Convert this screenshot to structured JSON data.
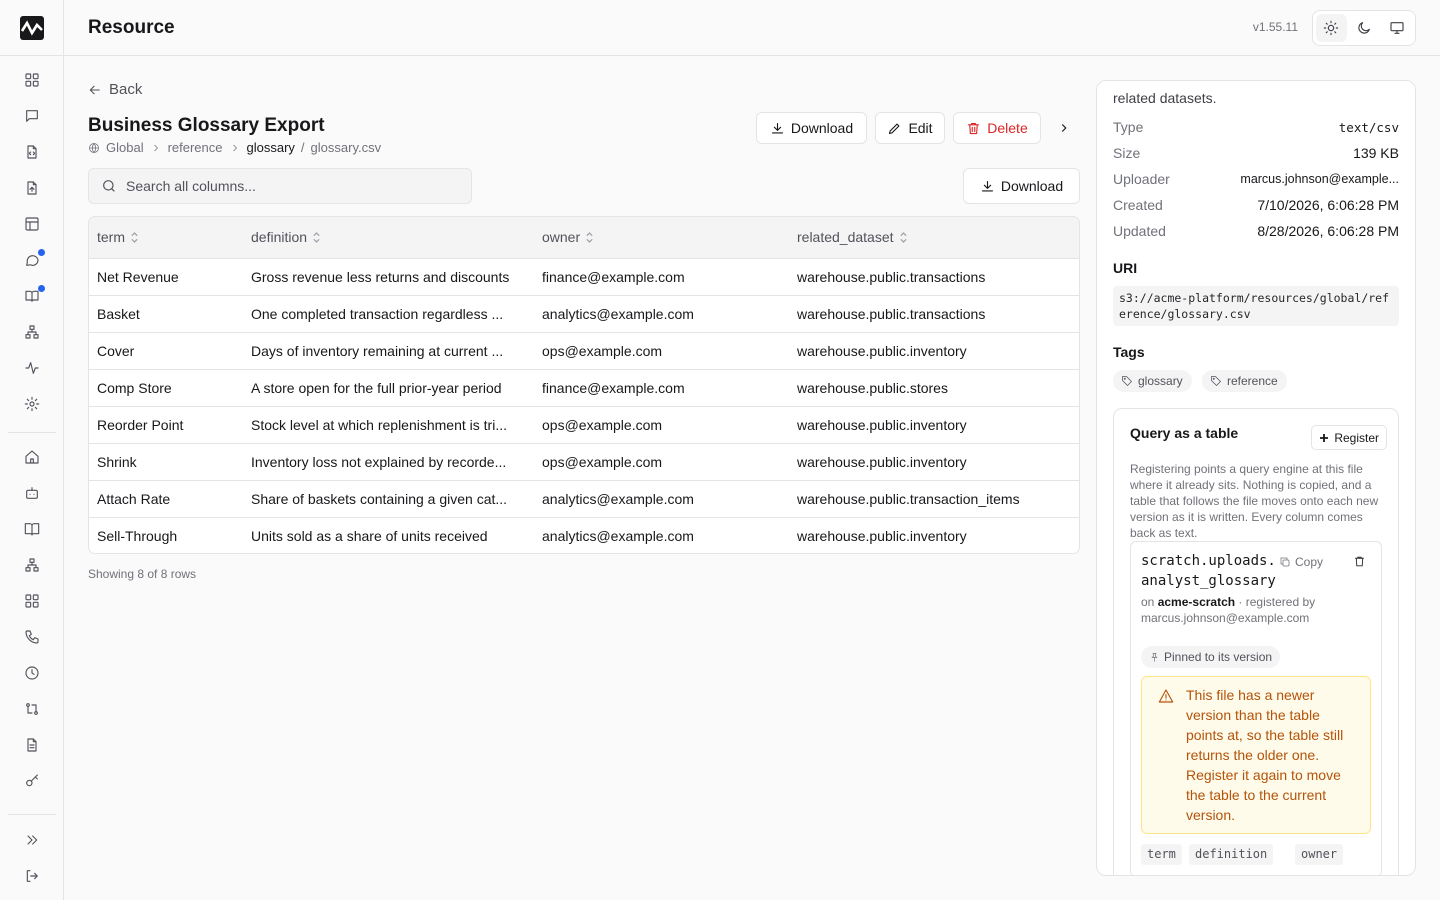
{
  "header": {
    "title": "Resource",
    "version": "v1.55.11"
  },
  "sidebar": {
    "icons": [
      "dashboard-icon",
      "chat-icon",
      "file-code-icon",
      "file-upload-icon",
      "table-icon",
      "messages-icon",
      "book-icon",
      "network-icon",
      "activity-icon",
      "settings-icon",
      "home-icon",
      "bot-icon",
      "book-open-icon",
      "org-chart-icon",
      "grid-icon",
      "phone-icon",
      "clock-icon",
      "git-compare-icon",
      "document-icon",
      "key-icon",
      "expand-icon",
      "logout-icon"
    ]
  },
  "page": {
    "back_label": "Back",
    "title": "Business Glossary Export",
    "breadcrumb": [
      "Global",
      "reference",
      "glossary",
      "glossary.csv"
    ],
    "actions": {
      "download": "Download",
      "edit": "Edit",
      "delete": "Delete"
    },
    "search_placeholder": "Search all columns...",
    "download_label": "Download",
    "row_count": "Showing 8 of 8 rows"
  },
  "table": {
    "columns": [
      "term",
      "definition",
      "owner",
      "related_dataset"
    ],
    "rows": [
      [
        "Net Revenue",
        "Gross revenue less returns and discounts",
        "finance@example.com",
        "warehouse.public.transactions"
      ],
      [
        "Basket",
        "One completed transaction regardless ...",
        "analytics@example.com",
        "warehouse.public.transactions"
      ],
      [
        "Cover",
        "Days of inventory remaining at current ...",
        "ops@example.com",
        "warehouse.public.inventory"
      ],
      [
        "Comp Store",
        "A store open for the full prior-year period",
        "finance@example.com",
        "warehouse.public.stores"
      ],
      [
        "Reorder Point",
        "Stock level at which replenishment is tri...",
        "ops@example.com",
        "warehouse.public.inventory"
      ],
      [
        "Shrink",
        "Inventory loss not explained by recorde...",
        "ops@example.com",
        "warehouse.public.inventory"
      ],
      [
        "Attach Rate",
        "Share of baskets containing a given cat...",
        "analytics@example.com",
        "warehouse.public.transaction_items"
      ],
      [
        "Sell-Through",
        "Units sold as a share of units received",
        "analytics@example.com",
        "warehouse.public.inventory"
      ]
    ]
  },
  "details": {
    "description_tail": "related datasets.",
    "meta": [
      {
        "key": "Type",
        "value": "text/csv"
      },
      {
        "key": "Size",
        "value": "139 KB"
      },
      {
        "key": "Uploader",
        "value": "marcus.johnson@example..."
      },
      {
        "key": "Created",
        "value": "7/10/2026, 6:06:28 PM"
      },
      {
        "key": "Updated",
        "value": "8/28/2026, 6:06:28 PM"
      }
    ],
    "uri_label": "URI",
    "uri": "s3://acme-platform/resources/global/reference/glossary.csv",
    "tags_label": "Tags",
    "tags": [
      "glossary",
      "reference"
    ]
  },
  "query": {
    "title": "Query as a table",
    "register_label": "Register",
    "description": "Registering points a query engine at this file where it already sits. Nothing is copied, and a table that follows the file moves onto each new version as it is written. Every column comes back as text.",
    "registration": {
      "name_line1": "scratch.uploads.",
      "name_line2": "analyst_glossary",
      "copy_label": "Copy",
      "on_label": "on",
      "engine": "acme-scratch",
      "registered_by_label": "registered by",
      "registered_by": "marcus.johnson@example.com",
      "pin_label": "Pinned to its version",
      "warning": "This file has a newer version than the table points at, so the table still returns the older one. Register it again to move the table to the current version.",
      "columns": [
        "term",
        "definition",
        "owner"
      ]
    }
  }
}
